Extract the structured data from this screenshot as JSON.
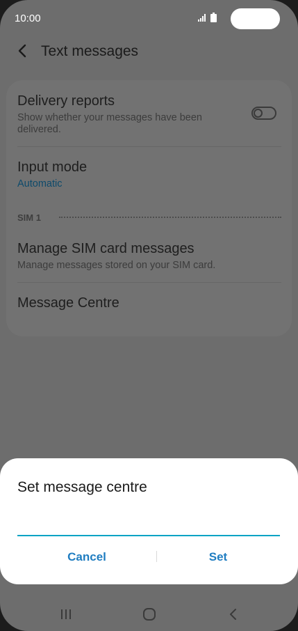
{
  "status_bar": {
    "time": "10:00"
  },
  "header": {
    "title": "Text messages",
    "back_icon": "chevron-left-icon"
  },
  "settings": {
    "delivery_reports": {
      "title": "Delivery reports",
      "subtitle": "Show whether your messages have been delivered.",
      "toggle_on": false
    },
    "input_mode": {
      "title": "Input mode",
      "value": "Automatic"
    },
    "section_sim": "SIM 1",
    "manage_sim": {
      "title": "Manage SIM card messages",
      "subtitle": "Manage messages stored on your SIM card."
    },
    "message_centre": {
      "title": "Message Centre"
    }
  },
  "dialog": {
    "title": "Set message centre",
    "input_value": "",
    "cancel_label": "Cancel",
    "set_label": "Set"
  },
  "colors": {
    "accent_blue": "#1f7dc1",
    "input_underline": "#00a3c4",
    "dim_overlay": "#6d6d6d"
  },
  "nav_bar": {
    "recents_icon": "recents-icon",
    "home_icon": "home-icon",
    "back_icon": "back-icon"
  }
}
